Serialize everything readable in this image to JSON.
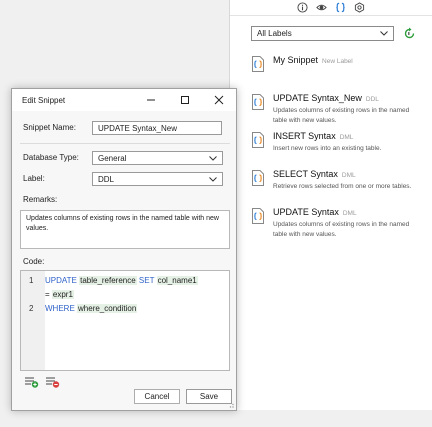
{
  "panel": {
    "toolbar_icons": [
      "info-icon",
      "eye-icon",
      "code-braces-icon",
      "settings-hexagon-icon"
    ],
    "filter": {
      "selected": "All Labels"
    },
    "snippets": [
      {
        "name": "My Snippet",
        "label": "New Label",
        "description": ""
      },
      {
        "name": "UPDATE Syntax_New",
        "label": "DDL",
        "description": "Updates columns of existing rows in the named table with new values."
      },
      {
        "name": "INSERT Syntax",
        "label": "DML",
        "description": "Insert new rows into an existing table."
      },
      {
        "name": "SELECT Syntax",
        "label": "DML",
        "description": "Retrieve rows selected from one or more tables."
      },
      {
        "name": "UPDATE Syntax",
        "label": "DML",
        "description": "Updates columns of existing rows in the named table with new values."
      }
    ]
  },
  "dialog": {
    "title": "Edit Snippet",
    "snippet_name_label": "Snippet Name:",
    "snippet_name_value": "UPDATE Syntax_New",
    "db_type_label": "Database Type:",
    "db_type_value": "General",
    "label_label": "Label:",
    "label_value": "DDL",
    "remarks_label": "Remarks:",
    "remarks_value": "Updates columns of existing rows in the named table with new values.",
    "code_label": "Code:",
    "code": {
      "line1_num": "1",
      "line2_num": "2",
      "kw_update": "UPDATE",
      "tok_table_reference": "table_reference",
      "kw_set": "SET",
      "tok_col_name1": "col_name1",
      "tok_eq": "=",
      "tok_expr1": "expr1",
      "kw_where": "WHERE",
      "tok_where_condition": "where_condition"
    },
    "cancel_label": "Cancel",
    "save_label": "Save"
  },
  "colors": {
    "keyword": "#2f62c8",
    "token_highlight": "#e6f1e6",
    "snippet_icon_blue": "#2f7fd6",
    "snippet_icon_orange": "#e8851e",
    "add_green": "#2e9d3e",
    "remove_red": "#d94141"
  }
}
